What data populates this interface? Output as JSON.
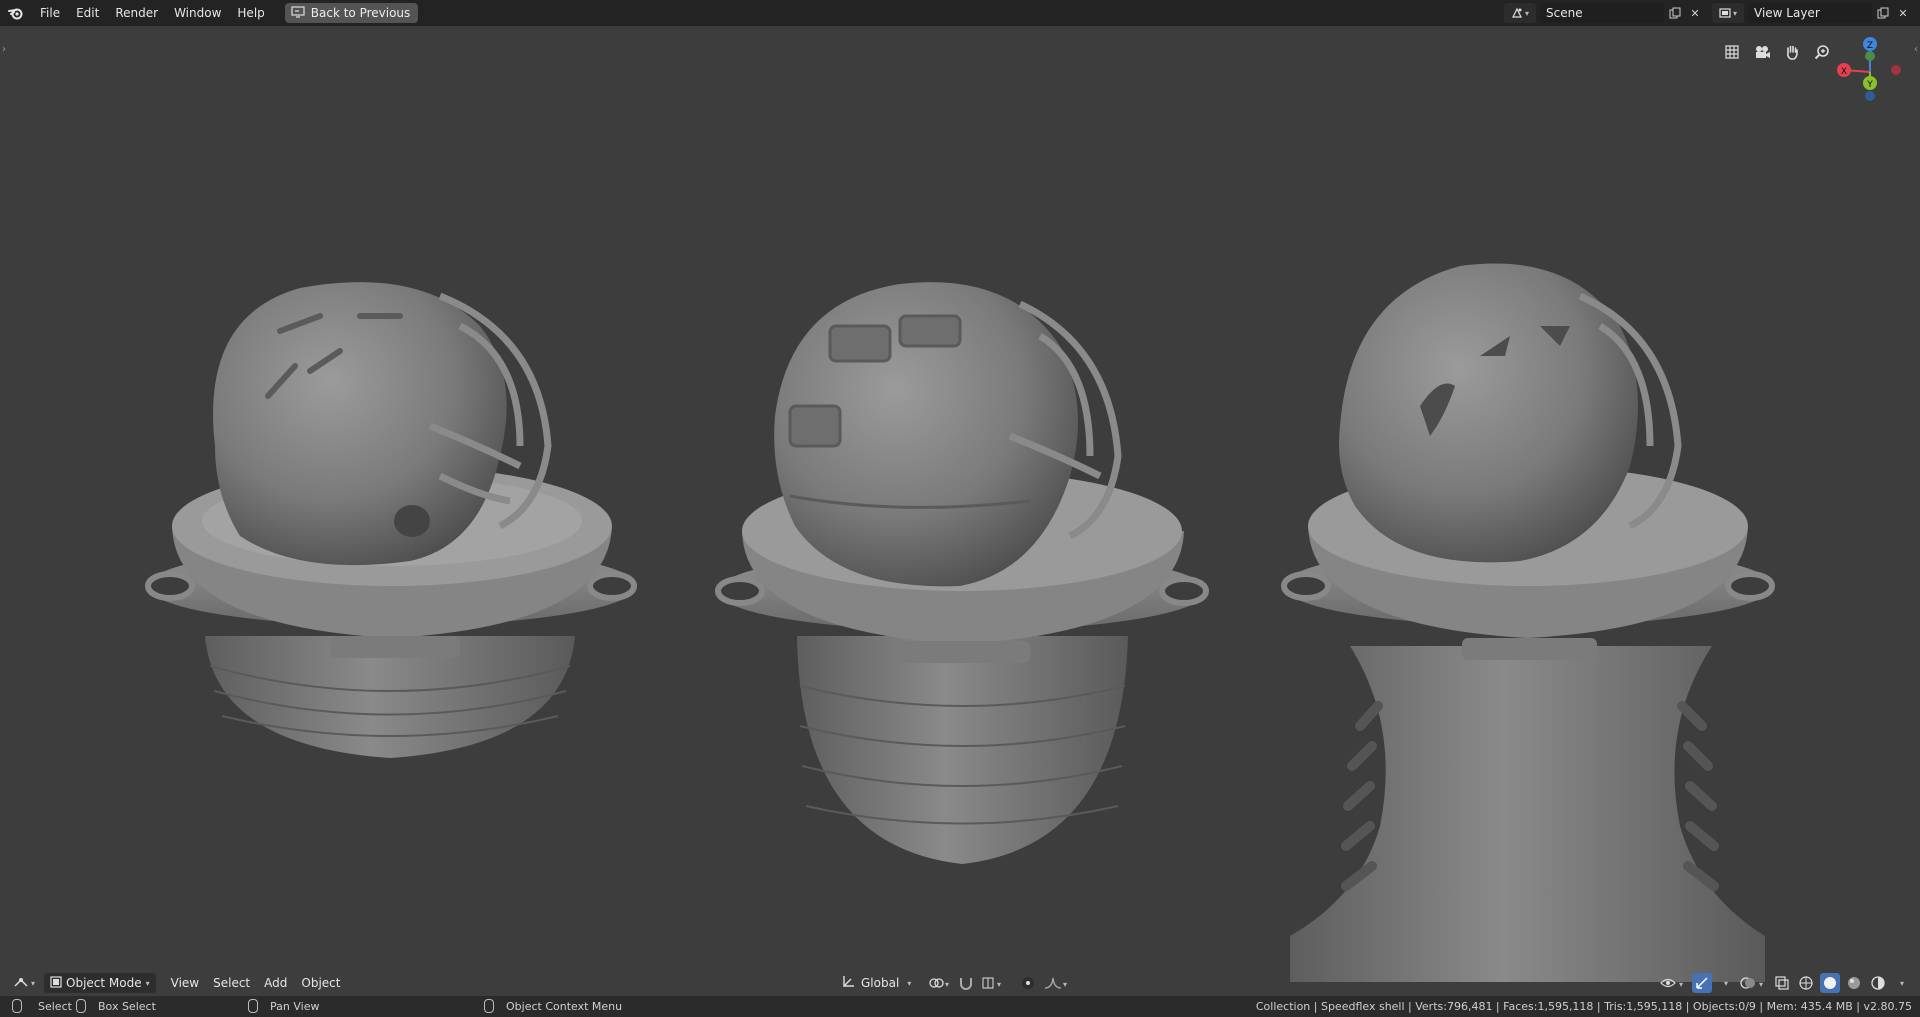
{
  "menubar": {
    "logo": "blender-logo-icon",
    "items": [
      "File",
      "Edit",
      "Render",
      "Window",
      "Help"
    ],
    "back_button": "Back to Previous"
  },
  "scene": {
    "label": "Scene",
    "icon": "scene-icon"
  },
  "view_layer": {
    "label": "View Layer",
    "icon": "view-layer-icon"
  },
  "gizmo": {
    "x": "X",
    "y": "Y",
    "z": "Z"
  },
  "header": {
    "mode": "Object Mode",
    "menus": [
      "View",
      "Select",
      "Add",
      "Object"
    ],
    "transform_orientation": "Global"
  },
  "statusbar": {
    "select": "Select",
    "box_select": "Box Select",
    "pan_view": "Pan View",
    "context_menu": "Object Context Menu",
    "stats": "Collection | Speedflex shell | Verts:796,481 | Faces:1,595,118 | Tris:1,595,118 | Objects:0/9 | Mem: 435.4 MB | v2.80.75"
  },
  "colors": {
    "background": "#3d3d3d",
    "topbar": "#232323",
    "accent": "#4772b3",
    "axis_x": "#e5404f",
    "axis_y": "#8bc02d",
    "axis_z": "#3f86e0"
  }
}
